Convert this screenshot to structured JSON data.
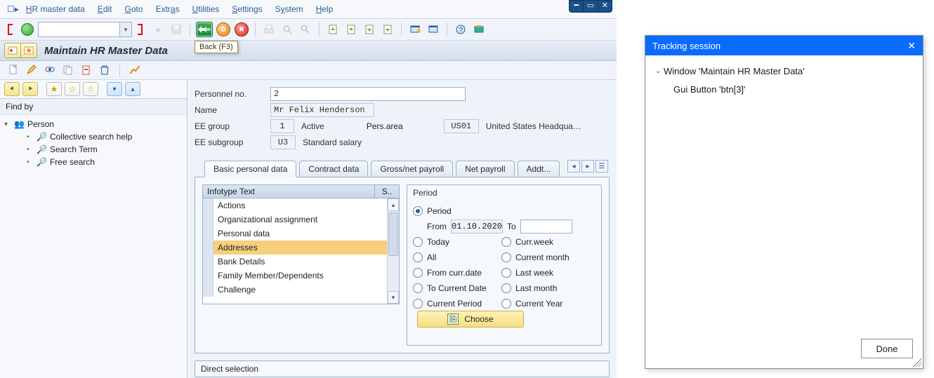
{
  "menu": {
    "items": [
      "HR master data",
      "Edit",
      "Goto",
      "Extras",
      "Utilities",
      "Settings",
      "System",
      "Help"
    ]
  },
  "toolbar": {
    "back_tooltip": "Back   (F3)"
  },
  "page_title": "Maintain HR Master Data",
  "findby_label": "Find by",
  "tree": {
    "root": "Person",
    "children": [
      "Collective search help",
      "Search Term",
      "Free search"
    ]
  },
  "form": {
    "personnel_label": "Personnel no.",
    "personnel_value": "2",
    "name_label": "Name",
    "name_value": "Mr Felix Henderson",
    "eegroup_label": "EE group",
    "eegroup_code": "1",
    "eegroup_text": "Active",
    "persarea_label": "Pers.area",
    "persarea_code": "US01",
    "persarea_text": "United States Headqua…",
    "eesub_label": "EE subgroup",
    "eesub_code": "U3",
    "eesub_text": "Standard salary"
  },
  "tabs": [
    "Basic personal data",
    "Contract data",
    "Gross/net payroll",
    "Net payroll",
    "Addt..."
  ],
  "infotable": {
    "h1": "Infotype Text",
    "h2": "S..",
    "rows": [
      {
        "t": "Actions",
        "s": true
      },
      {
        "t": "Organizational assignment",
        "s": true
      },
      {
        "t": "Personal data",
        "s": true
      },
      {
        "t": "Addresses",
        "s": true,
        "sel": true
      },
      {
        "t": "Bank Details",
        "s": true
      },
      {
        "t": "Family Member/Dependents",
        "s": true
      },
      {
        "t": "Challenge",
        "s": false
      }
    ]
  },
  "period": {
    "title": "Period",
    "opt_period": "Period",
    "from_label": "From",
    "from_value": "01.10.2020",
    "to_label": "To",
    "to_value": "",
    "today": "Today",
    "currweek": "Curr.week",
    "all": "All",
    "currmonth": "Current month",
    "fromcurr": "From curr.date",
    "lastweek": "Last week",
    "tocurr": "To Current Date",
    "lastmonth": "Last month",
    "currperiod": "Current Period",
    "curryear": "Current Year",
    "choose": "Choose"
  },
  "direct_selection": "Direct selection",
  "tracker": {
    "title": "Tracking session",
    "line1": "Window 'Maintain HR Master Data'",
    "line2": "Gui Button 'btn[3]'",
    "done": "Done"
  }
}
